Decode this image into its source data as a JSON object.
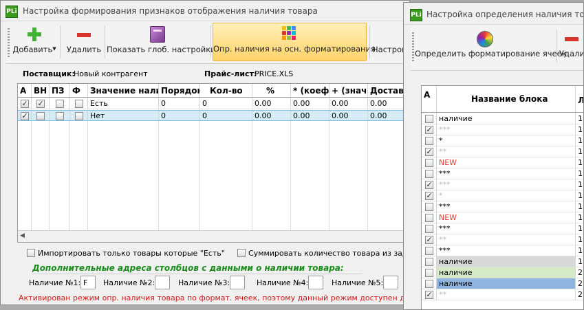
{
  "window1": {
    "app_icon": "PLi",
    "title": "Настройка формирования признаков отображения наличия товара",
    "toolbar": {
      "add_label": "Добавить",
      "add_icon": "plus-icon",
      "delete_label": "Удалить",
      "delete_icon": "minus-icon",
      "show_global_label": "Показать глоб. настройки",
      "show_global_icon": "book-icon",
      "availability_format_label": "Опр. наличия на осн. форматирования",
      "availability_format_icon": "color-tiles-icon",
      "settings_label": "Настрой"
    },
    "supplier_label": "Поставщик:",
    "supplier_value": "Новый контрагент",
    "pricelist_label": "Прайс-лист:",
    "pricelist_value": "PRICE.XLS",
    "columns": [
      "А",
      "ВН",
      "ПЗ",
      "Ф",
      "Значение налич",
      "Порядок",
      "Кол-во",
      "%",
      "* (коеф.)",
      "+ (знач.)",
      "Доставк"
    ],
    "rows": [
      {
        "a": true,
        "vn": true,
        "pz": false,
        "f": false,
        "value": "Есть",
        "order": "0",
        "qty": "0",
        "pct": "0.00",
        "coef": "0.00",
        "add": "0.00",
        "delivery": "0.00"
      },
      {
        "a": true,
        "vn": false,
        "pz": false,
        "f": false,
        "value": "Нет",
        "order": "0",
        "qty": "0",
        "pct": "0.00",
        "coef": "0.00",
        "add": "0.00",
        "delivery": "0.00"
      }
    ],
    "import_only_label": "Импортировать только товары которые \"Есть\"",
    "sum_qty_label": "Суммировать количество товара из заданны",
    "extra_heading": "Дополнительные адреса столбцов с данными о наличии товара:",
    "availability_fields": [
      {
        "label": "Наличие №1:",
        "value": "F"
      },
      {
        "label": "Наличие №2:",
        "value": ""
      },
      {
        "label": "Наличие №3:",
        "value": ""
      },
      {
        "label": "Наличие №4:",
        "value": ""
      },
      {
        "label": "Наличие №5:",
        "value": ""
      }
    ],
    "status": "Активирован режим опр. наличия товара по формат. ячеек, поэтому данный режим доступен для настройки"
  },
  "window2": {
    "app_icon": "PLi",
    "title": "Настройка определения наличия товара на",
    "toolbar": {
      "define_format_label": "Определить форматирование ячеек",
      "define_format_icon": "color-wheel-icon",
      "delete_label": "Удали"
    },
    "columns": [
      "А",
      "Название блока",
      "Л"
    ],
    "rows": [
      {
        "a": false,
        "name": "наличие",
        "color": "#000000",
        "bg": "#ffffff",
        "num": "1"
      },
      {
        "a": true,
        "name": "***",
        "color": "#b8b8b8",
        "bg": "#ffffff",
        "num": "1"
      },
      {
        "a": false,
        "name": "*",
        "color": "#000000",
        "bg": "#ffffff",
        "num": "1"
      },
      {
        "a": true,
        "name": "**",
        "color": "#b8b8b8",
        "bg": "#ffffff",
        "num": "1"
      },
      {
        "a": false,
        "name": "NEW",
        "color": "#e53935",
        "bg": "#ffffff",
        "num": "1"
      },
      {
        "a": false,
        "name": "***",
        "color": "#000000",
        "bg": "#ffffff",
        "num": "1"
      },
      {
        "a": true,
        "name": "***",
        "color": "#b8b8b8",
        "bg": "#ffffff",
        "num": "1"
      },
      {
        "a": true,
        "name": "*",
        "color": "#b8b8b8",
        "bg": "#ffffff",
        "num": "1"
      },
      {
        "a": false,
        "name": "***",
        "color": "#000000",
        "bg": "#ffffff",
        "num": "1"
      },
      {
        "a": false,
        "name": "NEW",
        "color": "#e53935",
        "bg": "#ffffff",
        "num": "1"
      },
      {
        "a": false,
        "name": "***",
        "color": "#000000",
        "bg": "#ffffff",
        "num": "1"
      },
      {
        "a": true,
        "name": "**",
        "color": "#b8b8b8",
        "bg": "#ffffff",
        "num": "1"
      },
      {
        "a": false,
        "name": "***",
        "color": "#000000",
        "bg": "#ffffff",
        "num": "1"
      },
      {
        "a": false,
        "name": "наличие",
        "color": "#000000",
        "bg": "#d9d9d9",
        "num": "1"
      },
      {
        "a": false,
        "name": "наличие",
        "color": "#000000",
        "bg": "#d6e9c6",
        "num": "2"
      },
      {
        "a": false,
        "name": "наличие",
        "color": "#000000",
        "bg": "#8fb4e0",
        "num": "2"
      },
      {
        "a": true,
        "name": "**",
        "color": "#b8b8b8",
        "bg": "#ffffff",
        "num": "2"
      }
    ]
  }
}
